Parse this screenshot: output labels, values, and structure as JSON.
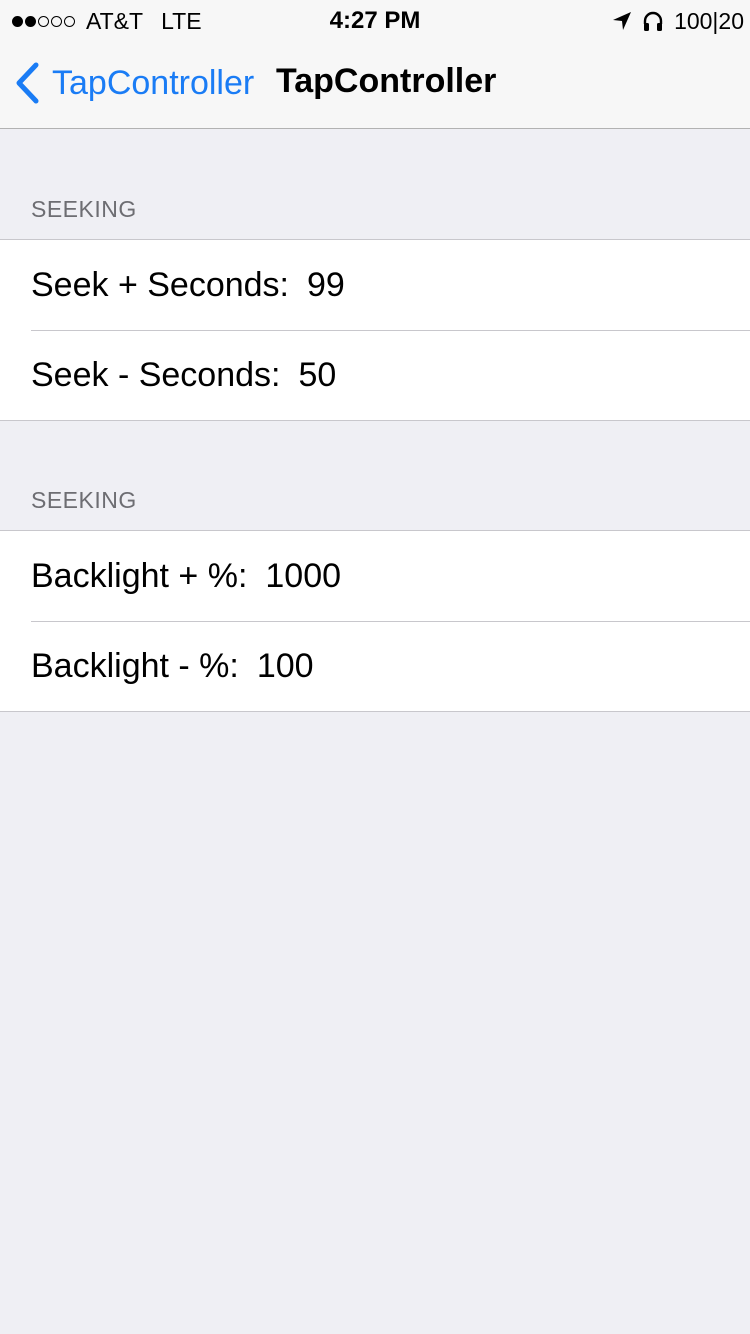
{
  "status_bar": {
    "carrier": "AT&T",
    "network": "LTE",
    "time": "4:27 PM",
    "battery": "100|20",
    "signal_bars_filled": 2,
    "signal_bars_total": 5,
    "icons": [
      "location-arrow-icon",
      "headphones-icon"
    ]
  },
  "nav": {
    "back_label": "TapController",
    "title": "TapController",
    "accent_color": "#1a7cf5"
  },
  "sections": [
    {
      "header": "SEEKING",
      "rows": [
        {
          "label": "Seek + Seconds:",
          "value": "99"
        },
        {
          "label": "Seek - Seconds:",
          "value": "50"
        }
      ]
    },
    {
      "header": "SEEKING",
      "rows": [
        {
          "label": "Backlight + %:",
          "value": "1000"
        },
        {
          "label": "Backlight - %:",
          "value": "100"
        }
      ]
    }
  ]
}
